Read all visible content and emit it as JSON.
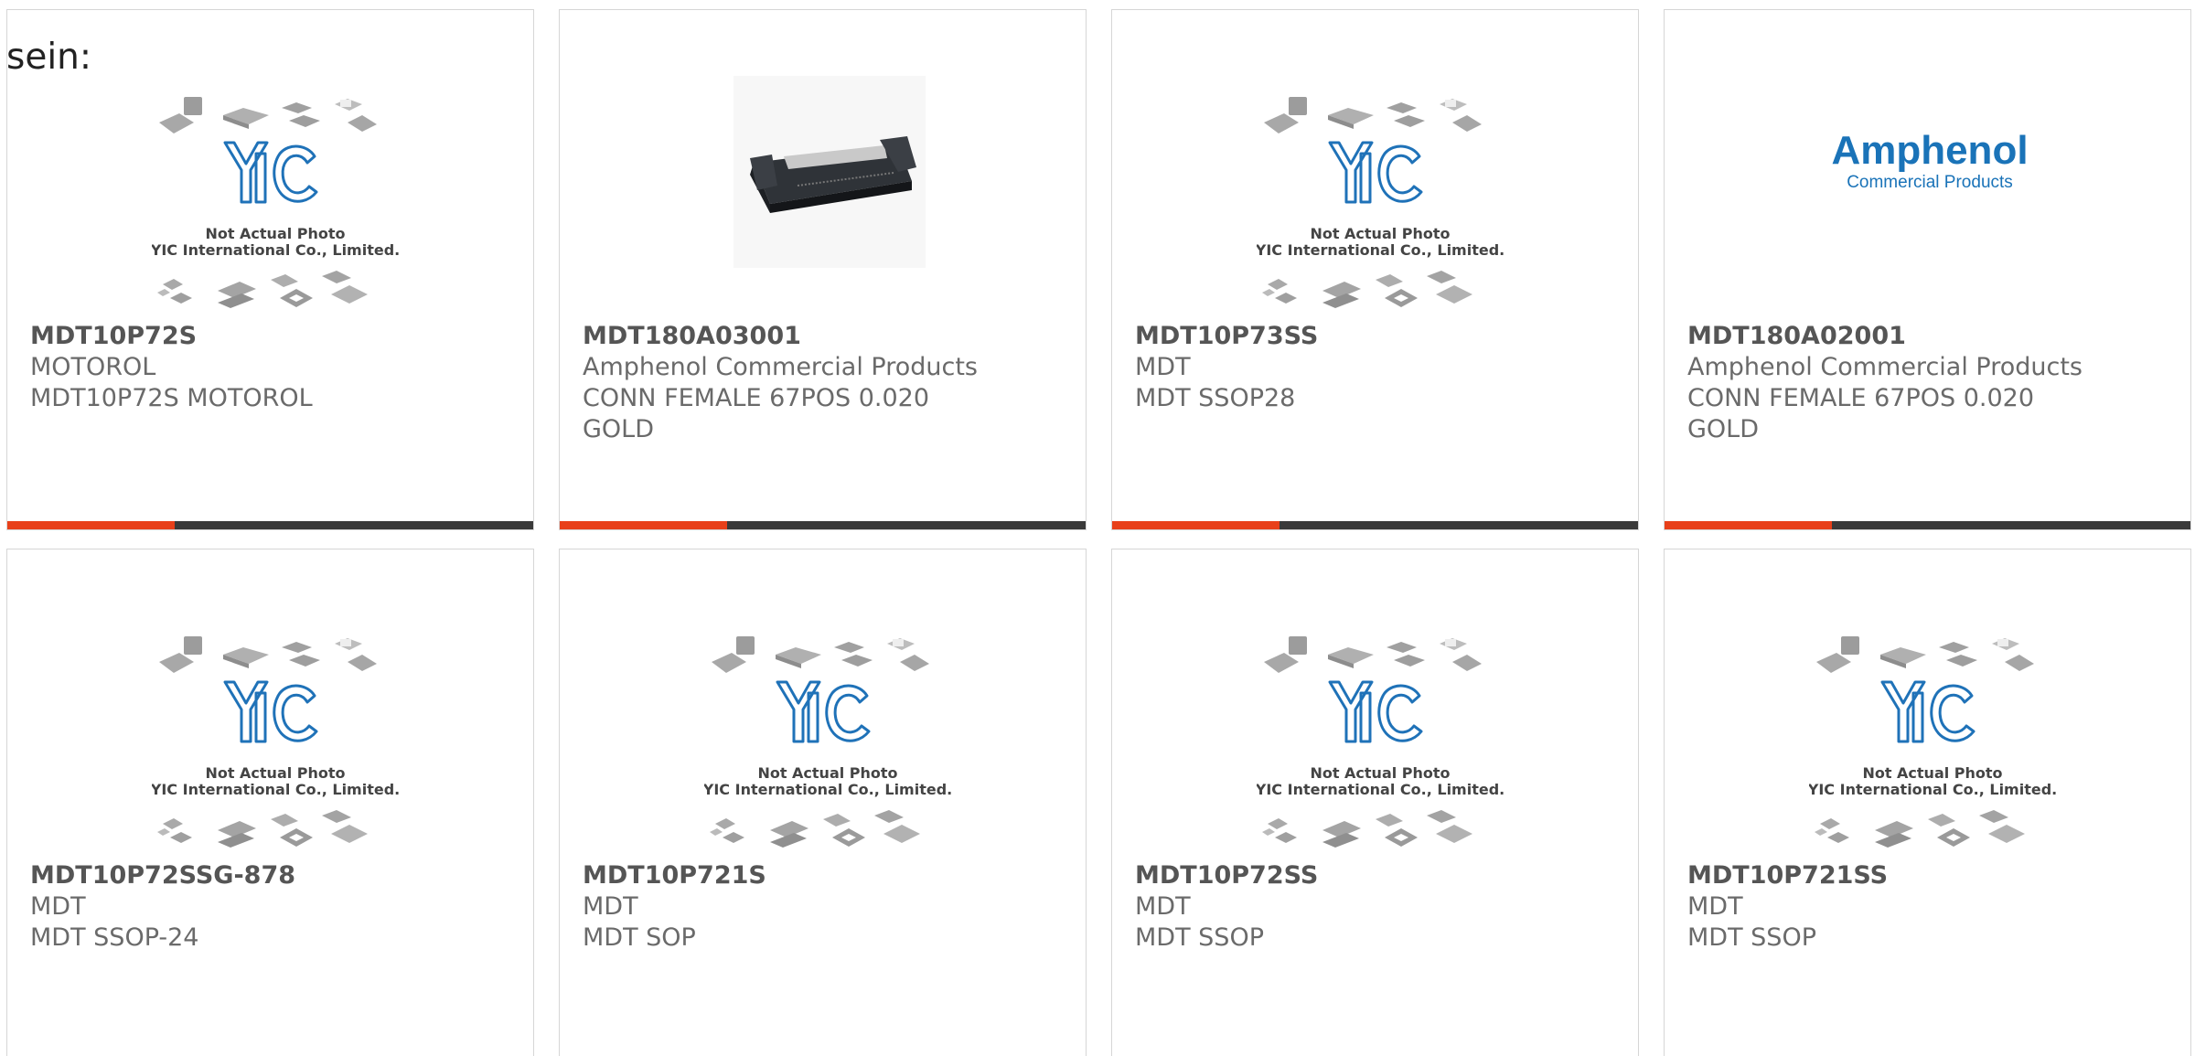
{
  "lead_text": "sein:",
  "placeholder_caption": {
    "line1": "Not Actual Photo",
    "line2": "YIC International Co., Limited."
  },
  "logo": {
    "brand": "Amphenol",
    "sub": "Commercial Products"
  },
  "colors": {
    "accent": "#e8401a",
    "bar": "#3a3a3a",
    "yic_blue": "#1f72b8",
    "amphenol_blue": "#1a73b8"
  },
  "products": [
    {
      "part": "MDT10P72S",
      "maker": "MOTOROL",
      "desc": "MDT10P72S MOTOROL",
      "desc2": "",
      "image": "placeholder"
    },
    {
      "part": "MDT180A03001",
      "maker": "Amphenol Commercial Products",
      "desc": "CONN FEMALE 67POS 0.020",
      "desc2": "GOLD",
      "image": "photo"
    },
    {
      "part": "MDT10P73SS",
      "maker": "MDT",
      "desc": "MDT SSOP28",
      "desc2": "",
      "image": "placeholder"
    },
    {
      "part": "MDT180A02001",
      "maker": "Amphenol Commercial Products",
      "desc": "CONN FEMALE 67POS 0.020",
      "desc2": "GOLD",
      "image": "logo"
    },
    {
      "part": "MDT10P72SSG-878",
      "maker": "MDT",
      "desc": "MDT SSOP-24",
      "desc2": "",
      "image": "placeholder"
    },
    {
      "part": "MDT10P721S",
      "maker": "MDT",
      "desc": "MDT SOP",
      "desc2": "",
      "image": "placeholder"
    },
    {
      "part": "MDT10P72SS",
      "maker": "MDT",
      "desc": "MDT SSOP",
      "desc2": "",
      "image": "placeholder"
    },
    {
      "part": "MDT10P721SS",
      "maker": "MDT",
      "desc": "MDT SSOP",
      "desc2": "",
      "image": "placeholder"
    }
  ]
}
